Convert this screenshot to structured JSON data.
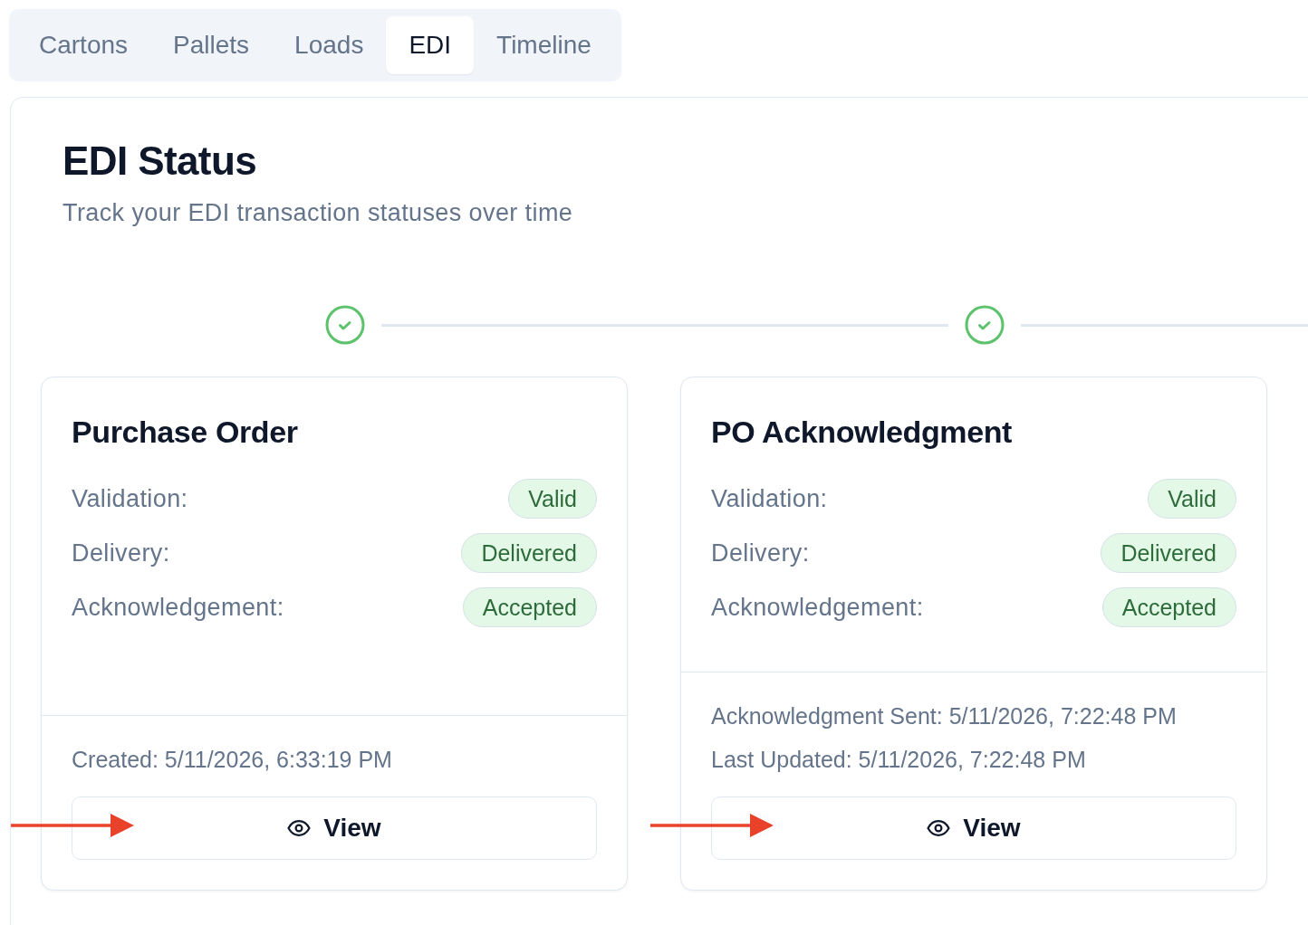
{
  "tabs": [
    {
      "label": "Cartons",
      "selected": false
    },
    {
      "label": "Pallets",
      "selected": false
    },
    {
      "label": "Loads",
      "selected": false
    },
    {
      "label": "EDI",
      "selected": true
    },
    {
      "label": "Timeline",
      "selected": false
    }
  ],
  "header": {
    "title": "EDI Status",
    "subtitle": "Track your EDI transaction statuses over time"
  },
  "timeline": {
    "continues": true
  },
  "documents": [
    {
      "title": "Purchase Order",
      "completed": true,
      "statuses": [
        {
          "label": "Validation:",
          "value": "Valid"
        },
        {
          "label": "Delivery:",
          "value": "Delivered"
        },
        {
          "label": "Acknowledgement:",
          "value": "Accepted"
        }
      ],
      "details": [
        "Created: 5/11/2026, 6:33:19 PM"
      ],
      "view_button": {
        "label": "View",
        "annotated": true
      }
    },
    {
      "title": "PO Acknowledgment",
      "completed": true,
      "statuses": [
        {
          "label": "Validation:",
          "value": "Valid"
        },
        {
          "label": "Delivery:",
          "value": "Delivered"
        },
        {
          "label": "Acknowledgement:",
          "value": "Accepted"
        }
      ],
      "details": [
        "Acknowledgment Sent: 5/11/2026, 7:22:48 PM",
        "Last Updated: 5/11/2026, 7:22:48 PM"
      ],
      "view_button": {
        "label": "View",
        "annotated": true
      }
    }
  ]
}
